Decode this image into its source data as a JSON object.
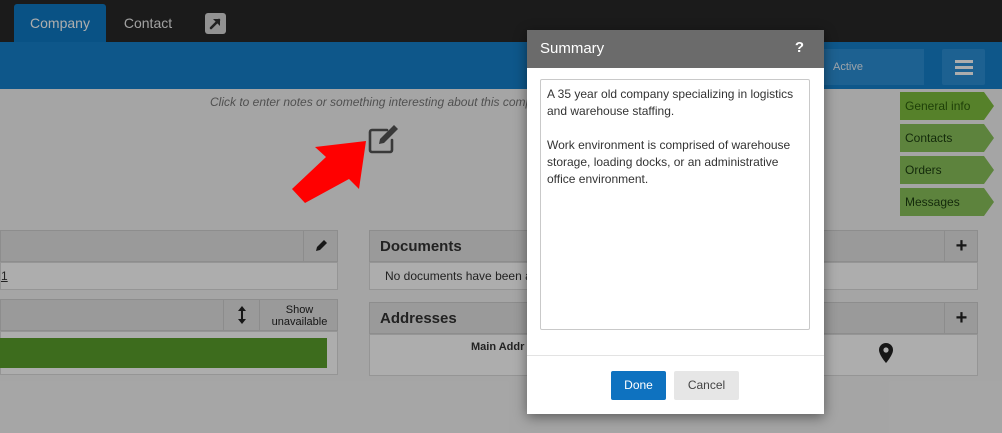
{
  "nav": {
    "tabs": [
      {
        "label": "Company"
      },
      {
        "label": "Contact"
      }
    ]
  },
  "header": {
    "status": "Active"
  },
  "notes": {
    "hint": "Click to enter notes or something interesting about this comp"
  },
  "side_tabs": [
    {
      "label": "General info"
    },
    {
      "label": "Contacts"
    },
    {
      "label": "Orders"
    },
    {
      "label": "Messages"
    }
  ],
  "panels": {
    "left_link": "1",
    "show_unavailable": "Show unavailable",
    "documents": {
      "title": "Documents",
      "empty_text": "No documents have been a"
    },
    "addresses": {
      "title": "Addresses",
      "column": "Main Addr"
    }
  },
  "modal": {
    "title": "Summary",
    "help": "?",
    "summary_text": "A 35 year old company specializing in logistics and warehouse staffing.\n\nWork environment is comprised of warehouse storage, loading docks, or an administrative office environment.",
    "done_label": "Done",
    "cancel_label": "Cancel"
  },
  "colors": {
    "brand_blue": "#1680cc",
    "nav_dark": "#282828",
    "side_tab_green": "#8ac25b",
    "done_button": "#0e72c0",
    "arrow_red": "#ff0000"
  }
}
